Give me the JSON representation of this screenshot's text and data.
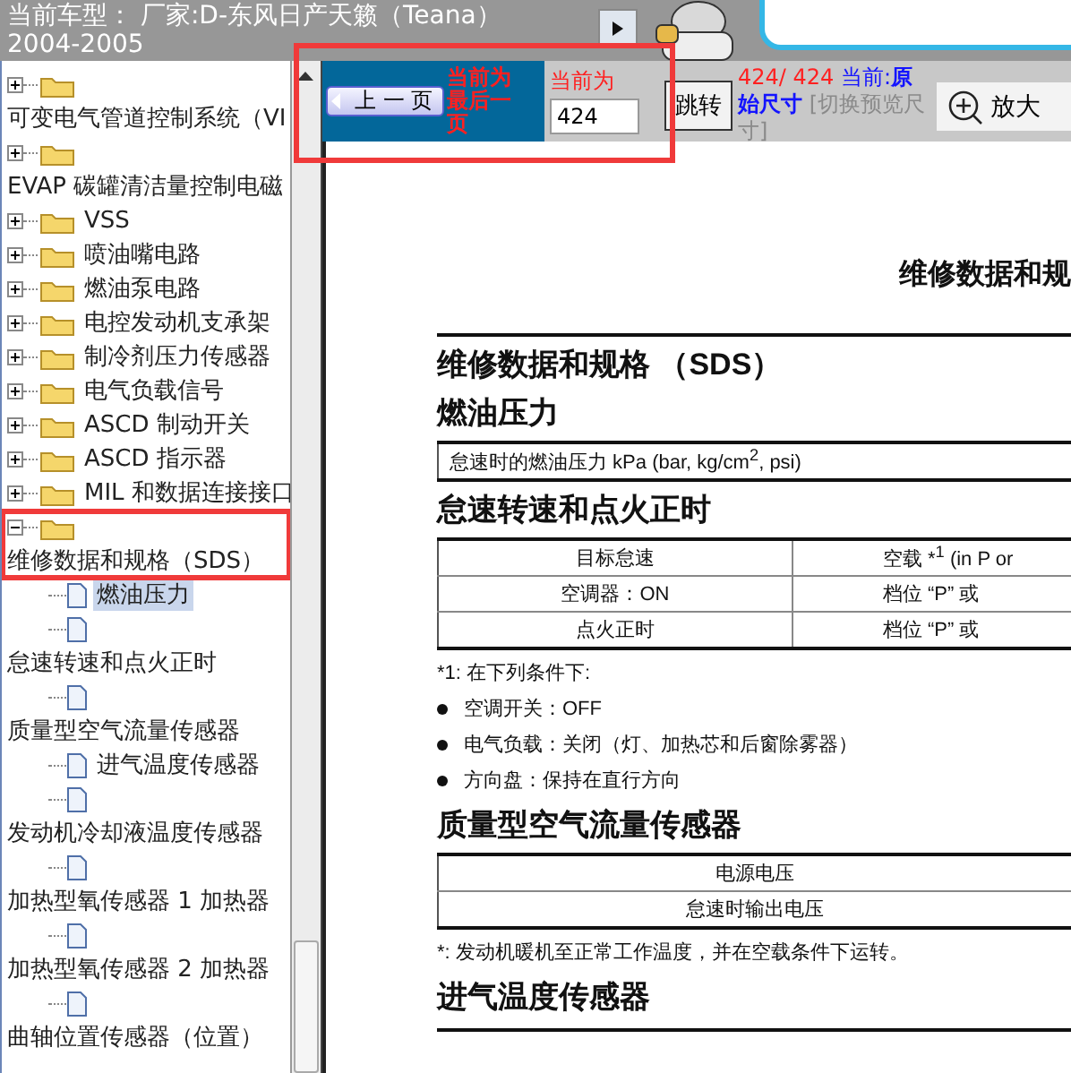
{
  "window": {
    "title": "当前车型： 厂家:D-东风日产天籁（Teana）2004-2005"
  },
  "toolbar": {
    "prev_button": "上 一 页",
    "last_page_notice": "当前为最后一页",
    "page_label": "当前为",
    "page_input": "424",
    "go_button": "跳转",
    "page_count": "424/ 424",
    "size_label": "当前:",
    "size_value": "原始尺寸",
    "size_toggle": "[切换预览尺寸]",
    "zoom_in_button": "放大"
  },
  "tree": [
    {
      "kind": "folder",
      "label": "可变电气管道控制系统（VI",
      "expanded": false,
      "selected": false,
      "label_below": true,
      "highlighted": false
    },
    {
      "kind": "folder",
      "label": "EVAP 碳罐清洁量控制电磁",
      "expanded": false,
      "selected": false,
      "label_below": true,
      "highlighted": false
    },
    {
      "kind": "folder",
      "label": "VSS",
      "expanded": false,
      "selected": false,
      "label_below": false,
      "highlighted": false
    },
    {
      "kind": "folder",
      "label": "喷油嘴电路",
      "expanded": false,
      "selected": false,
      "label_below": false,
      "highlighted": false
    },
    {
      "kind": "folder",
      "label": "燃油泵电路",
      "expanded": false,
      "selected": false,
      "label_below": false,
      "highlighted": false
    },
    {
      "kind": "folder",
      "label": "电控发动机支承架",
      "expanded": false,
      "selected": false,
      "label_below": false,
      "highlighted": false
    },
    {
      "kind": "folder",
      "label": "制冷剂压力传感器",
      "expanded": false,
      "selected": false,
      "label_below": false,
      "highlighted": false
    },
    {
      "kind": "folder",
      "label": "电气负载信号",
      "expanded": false,
      "selected": false,
      "label_below": false,
      "highlighted": false
    },
    {
      "kind": "folder",
      "label": "ASCD 制动开关",
      "expanded": false,
      "selected": false,
      "label_below": false,
      "highlighted": false
    },
    {
      "kind": "folder",
      "label": "ASCD 指示器",
      "expanded": false,
      "selected": false,
      "label_below": false,
      "highlighted": false
    },
    {
      "kind": "folder",
      "label": "MIL 和数据连接接口",
      "expanded": false,
      "selected": false,
      "label_below": false,
      "highlighted": false
    },
    {
      "kind": "folder",
      "label": "维修数据和规格（SDS）",
      "expanded": true,
      "selected": false,
      "label_below": true,
      "highlighted": true,
      "children": [
        {
          "kind": "doc",
          "label": "燃油压力",
          "selected": true,
          "label_below": false,
          "highlighted": false
        },
        {
          "kind": "doc",
          "label": "怠速转速和点火正时",
          "selected": false,
          "label_below": true,
          "highlighted": false
        },
        {
          "kind": "doc",
          "label": "质量型空气流量传感器",
          "selected": false,
          "label_below": true,
          "highlighted": false
        },
        {
          "kind": "doc",
          "label": "进气温度传感器",
          "selected": false,
          "label_below": false,
          "highlighted": false
        },
        {
          "kind": "doc",
          "label": "发动机冷却液温度传感器",
          "selected": false,
          "label_below": true,
          "highlighted": false
        },
        {
          "kind": "doc",
          "label": "加热型氧传感器 1 加热器",
          "selected": false,
          "label_below": true,
          "highlighted": false
        },
        {
          "kind": "doc",
          "label": "加热型氧传感器 2 加热器",
          "selected": false,
          "label_below": true,
          "highlighted": false
        },
        {
          "kind": "doc",
          "label": "曲轴位置传感器（位置）",
          "selected": false,
          "label_below": true,
          "highlighted": false
        }
      ]
    }
  ],
  "document": [
    {
      "kind": "title",
      "text": "维修数据和规"
    },
    {
      "kind": "h1",
      "text": "维修数据和规格 （SDS）"
    },
    {
      "kind": "h2",
      "text": "燃油压力"
    },
    {
      "kind": "table_left",
      "rows": [
        [
          "怠速时的燃油压力 kPa (bar, kg/cm$^{2}$, psi)"
        ]
      ]
    },
    {
      "kind": "h2",
      "text": "怠速转速和点火正时"
    },
    {
      "kind": "table_center",
      "rows": [
        [
          "目标怠速",
          "空载 *$^{1}$ (in P or"
        ],
        [
          "空调器：ON",
          "档位 “P” 或"
        ],
        [
          "点火正时",
          "档位 “P” 或"
        ]
      ]
    },
    {
      "kind": "note",
      "text": "*1: 在下列条件下:"
    },
    {
      "kind": "bullet",
      "text": "空调开关：OFF"
    },
    {
      "kind": "bullet",
      "text": "电气负载：关闭（灯、加热芯和后窗除雾器）"
    },
    {
      "kind": "bullet",
      "text": "方向盘：保持在直行方向"
    },
    {
      "kind": "h2",
      "text": "质量型空气流量传感器"
    },
    {
      "kind": "table_center",
      "rows": [
        [
          "电源电压"
        ],
        [
          "怠速时输出电压"
        ]
      ]
    },
    {
      "kind": "note",
      "text": "*: 发动机暖机至正常工作温度，并在空载条件下运转。"
    },
    {
      "kind": "h2",
      "text": "进气温度传感器"
    },
    {
      "kind": "rule"
    }
  ]
}
